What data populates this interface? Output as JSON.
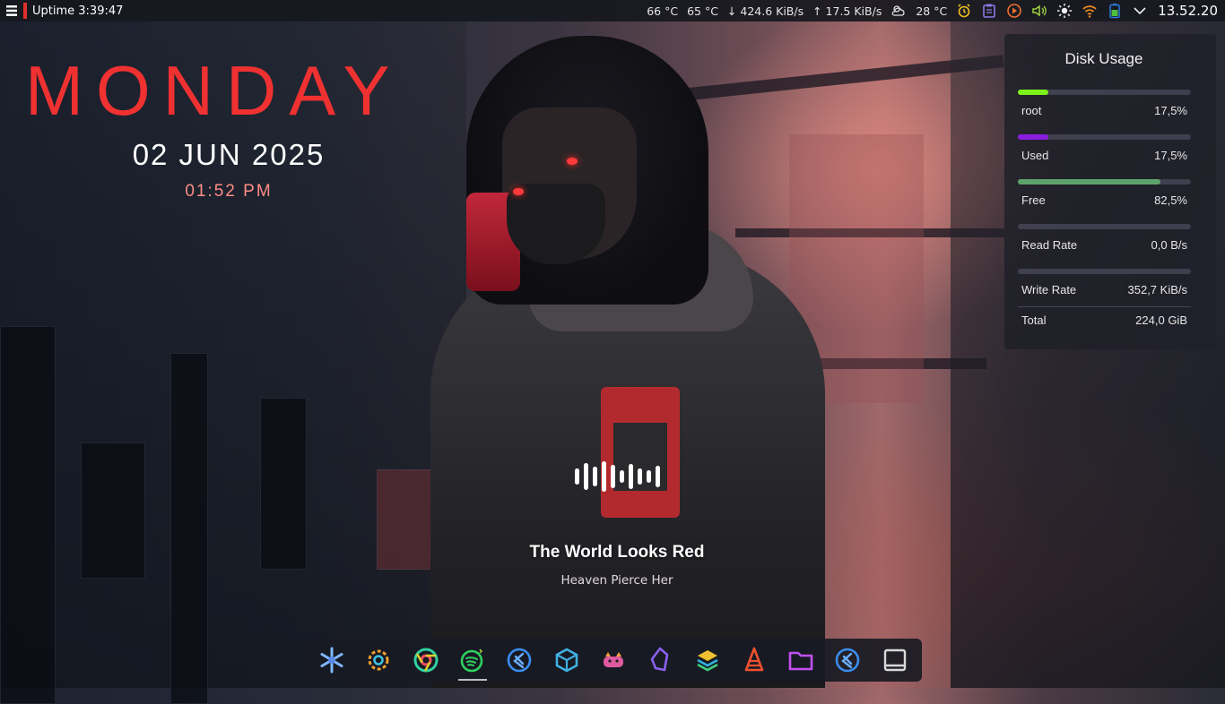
{
  "panel": {
    "launcher_icon": "kde-launcher-icon",
    "uptime": "Uptime 3:39:47",
    "temp_cpu": "66 °C",
    "temp_gpu": "65 °C",
    "net_down": "↓ 424.6 KiB/s",
    "net_up": "↑   17.5 KiB/s",
    "weather": "28 °C",
    "clock": "13.52.20",
    "tray_icons": [
      "weather-partly-cloudy-icon",
      "alarm-icon",
      "clipboard-icon",
      "media-player-icon",
      "volume-icon",
      "brightness-icon",
      "wifi-icon",
      "battery-icon",
      "expand-tray-icon"
    ]
  },
  "date_widget": {
    "day": "MONDAY",
    "date": "02 JUN 2025",
    "time": "01:52 PM"
  },
  "disk_widget": {
    "title": "Disk Usage",
    "rows": [
      {
        "label": "root",
        "value": "17,5%",
        "fill": 0.175,
        "color": "#7cf21a"
      },
      {
        "label": "Used",
        "value": "17,5%",
        "fill": 0.175,
        "color": "#8a1ee0"
      },
      {
        "label": "Free",
        "value": "82,5%",
        "fill": 0.825,
        "color": "#5da26a"
      },
      {
        "label": "Read Rate",
        "value": "0,0 B/s",
        "fill": 0,
        "color": "#5da26a"
      },
      {
        "label": "Write Rate",
        "value": "352,7 KiB/s",
        "fill": 0,
        "color": "#5da26a"
      }
    ],
    "total_label": "Total",
    "total_value": "224,0 GiB"
  },
  "music_widget": {
    "song": "The World Looks Red",
    "artist": "Heaven Pierce Her"
  },
  "dock": {
    "apps": [
      "snowflake-icon",
      "settings-icon",
      "chrome-icon",
      "spotify-icon",
      "vscode-icon",
      "virtualbox-icon",
      "gitkraken-icon",
      "obsidian-icon",
      "layers-icon",
      "vlc-icon",
      "files-icon",
      "vscode-insiders-icon",
      "terminal-icon"
    ]
  },
  "colors": {
    "accent_red": "#ef3131",
    "time_pink": "#ff8c85"
  }
}
